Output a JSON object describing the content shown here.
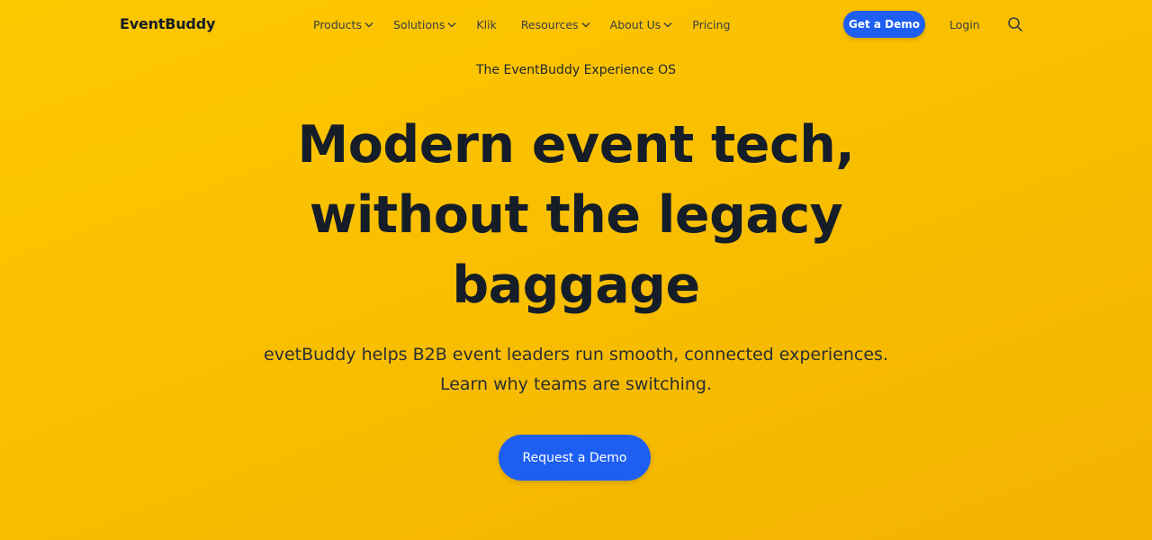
{
  "header": {
    "logo": "EventBuddy",
    "nav": [
      {
        "label": "Products",
        "dropdown": true
      },
      {
        "label": "Solutions",
        "dropdown": true
      },
      {
        "label": "Klik",
        "dropdown": false
      },
      {
        "label": "Resources",
        "dropdown": true
      },
      {
        "label": "About Us",
        "dropdown": true
      },
      {
        "label": "Pricing",
        "dropdown": false
      }
    ],
    "demo_label": "Get a Demo",
    "login_label": "Login",
    "search_icon": "search-icon"
  },
  "hero": {
    "eyebrow": "The EventBuddy Experience OS",
    "headline_lines": [
      "Modern event tech,",
      "without the legacy",
      "baggage"
    ],
    "subtitle_lines": [
      "evetBuddy helps B2B event leaders run smooth, connected experiences.",
      "Learn why teams are switching."
    ],
    "cta_label": "Request a Demo"
  },
  "colors": {
    "background": "#fbc400",
    "accent": "#1e5ff2",
    "heading": "#151d29"
  }
}
